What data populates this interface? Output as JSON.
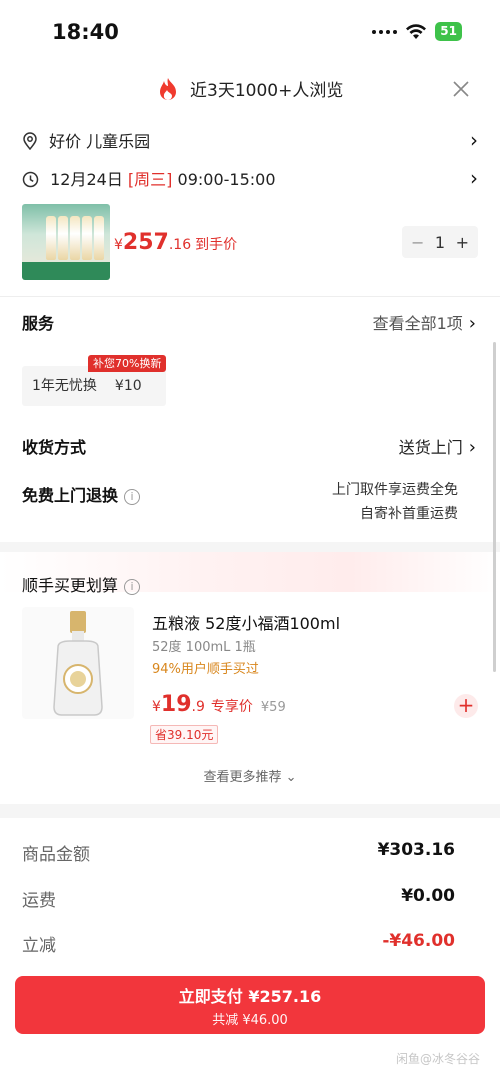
{
  "status_bar": {
    "time": "18:40",
    "battery": "51"
  },
  "header": {
    "title": "近3天1000+人浏览",
    "close_glyph": "×"
  },
  "location": {
    "label": "好价  儿童乐园"
  },
  "schedule": {
    "date": "12月24日",
    "weekday": "[周三]",
    "hours": "09:00-15:00"
  },
  "product": {
    "price_symbol": "¥",
    "price_int": "257",
    "price_dec": ".16",
    "price_label": "到手价",
    "quantity": "1",
    "minus": "−",
    "plus": "+"
  },
  "service": {
    "title": "服务",
    "link": "查看全部1项",
    "chip_label": "1年无忧换",
    "chip_price": "¥10",
    "chip_tag": "补您70%换新"
  },
  "delivery": {
    "title": "收货方式",
    "value": "送货上门"
  },
  "returns": {
    "title": "免费上门退换",
    "line1": "上门取件享运费全免",
    "line2": "自寄补首重运费"
  },
  "upsell": {
    "title": "顺手买更划算",
    "product_name": "五粮液 52度小福酒100ml",
    "spec": "52度 100mL 1瓶",
    "popularity": "94%用户顺手买过",
    "price_symbol": "¥",
    "price_int": "19",
    "price_dec": ".9",
    "price_label": "专享价",
    "original_price": "¥59",
    "save_label": "省39.10元",
    "more_link": "查看更多推荐 ⌄"
  },
  "summary": {
    "items": [
      {
        "key": "商品金额",
        "value": "¥303.16"
      },
      {
        "key": "运费",
        "value": "¥0.00"
      },
      {
        "key": "立减",
        "value": "-¥46.00"
      }
    ]
  },
  "cta": {
    "line1": "立即支付 ¥257.16",
    "line2": "共减 ¥46.00"
  },
  "watermark": "闲鱼@冰冬谷谷",
  "colors": {
    "accent": "#e0302c",
    "cta": "#f2363c"
  }
}
